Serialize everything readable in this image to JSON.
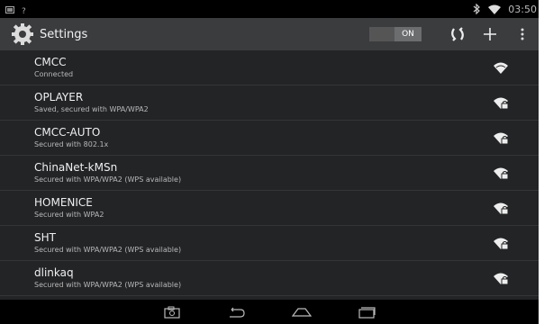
{
  "status_bar": {
    "time": "03:50",
    "icons": [
      "screenshot-notification-icon",
      "wifi-question-icon",
      "bluetooth-icon",
      "wifi-status-icon"
    ]
  },
  "action_bar": {
    "title": "Settings",
    "wifi_toggle": "ON",
    "icons": [
      "settings-gear-icon",
      "wps-icon",
      "add-icon",
      "overflow-menu-icon"
    ]
  },
  "networks": [
    {
      "ssid": "CMCC",
      "status": "Connected",
      "secured": false
    },
    {
      "ssid": "OPLAYER",
      "status": "Saved, secured with WPA/WPA2",
      "secured": true
    },
    {
      "ssid": "CMCC-AUTO",
      "status": "Secured with 802.1x",
      "secured": true
    },
    {
      "ssid": "ChinaNet-kMSn",
      "status": "Secured with WPA/WPA2 (WPS available)",
      "secured": true
    },
    {
      "ssid": "HOMENICE",
      "status": "Secured with WPA2",
      "secured": true
    },
    {
      "ssid": "SHT",
      "status": "Secured with WPA/WPA2 (WPS available)",
      "secured": true
    },
    {
      "ssid": "dlinkaq",
      "status": "Secured with WPA/WPA2 (WPS available)",
      "secured": true
    }
  ],
  "nav_bar": {
    "icons": [
      "screenshot-icon",
      "back-icon",
      "home-icon",
      "recent-apps-icon"
    ]
  }
}
